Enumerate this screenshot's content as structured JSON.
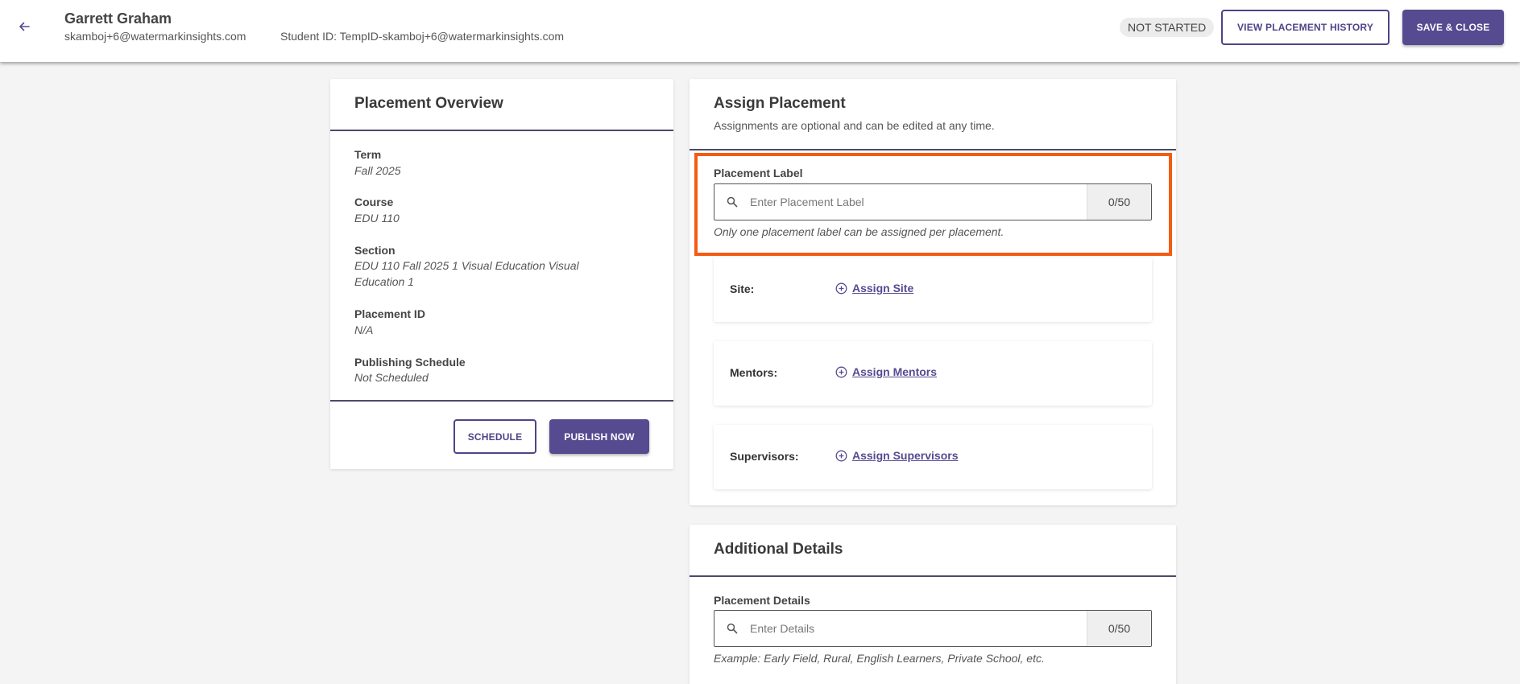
{
  "header": {
    "student_name": "Garrett Graham",
    "student_email": "skamboj+6@watermarkinsights.com",
    "student_id": "Student ID: TempID-skamboj+6@watermarkinsights.com",
    "status": "NOT STARTED",
    "view_history_label": "VIEW PLACEMENT HISTORY",
    "save_close_label": "SAVE & CLOSE",
    "back_icon": "arrow-left-icon"
  },
  "overview": {
    "title": "Placement Overview",
    "fields": [
      {
        "label": "Term",
        "value": "Fall 2025"
      },
      {
        "label": "Course",
        "value": "EDU 110"
      },
      {
        "label": "Section",
        "value": "EDU 110 Fall 2025 1 Visual Education Visual Education 1"
      },
      {
        "label": "Placement ID",
        "value": "N/A"
      },
      {
        "label": "Publishing Schedule",
        "value": "Not Scheduled"
      }
    ],
    "schedule_label": "SCHEDULE",
    "publish_label": "PUBLISH NOW"
  },
  "assign": {
    "title": "Assign Placement",
    "subtitle": "Assignments are optional and can be edited at any time.",
    "placement_label": {
      "label": "Placement Label",
      "placeholder": "Enter Placement Label",
      "value": "",
      "counter": "0/50",
      "helper": "Only one placement label can be assigned per placement."
    },
    "rows": [
      {
        "label": "Site:",
        "link": "Assign Site"
      },
      {
        "label": "Mentors:",
        "link": "Assign Mentors"
      },
      {
        "label": "Supervisors:",
        "link": "Assign Supervisors"
      }
    ]
  },
  "additional": {
    "title": "Additional Details",
    "details": {
      "label": "Placement Details",
      "placeholder": "Enter Details",
      "value": "",
      "counter": "0/50",
      "helper": "Example: Early Field, Rural, English Learners, Private School, etc."
    }
  },
  "colors": {
    "accent": "#564a91",
    "highlight": "#f45c12",
    "background": "#f4f4f4"
  }
}
